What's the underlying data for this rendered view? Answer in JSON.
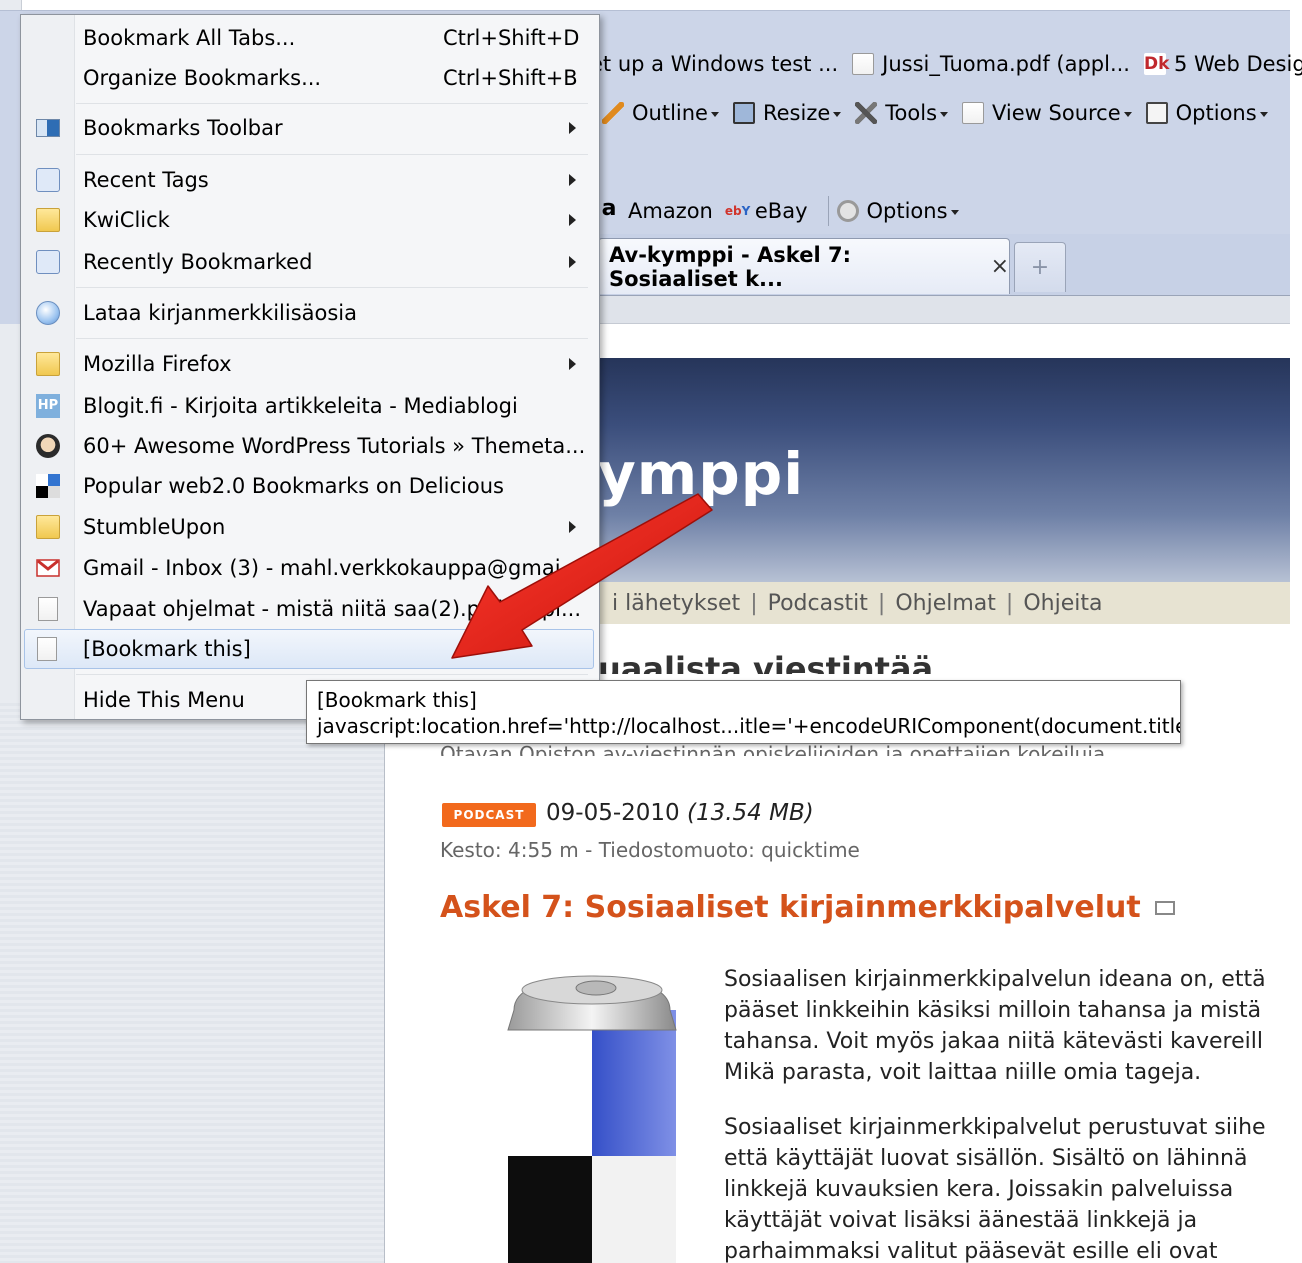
{
  "bookmarks_toolbar": {
    "items": [
      {
        "label": "et up a Windows test ...",
        "icon": "page-icon"
      },
      {
        "label": "Jussi_Tuoma.pdf (appl...",
        "icon": "page-icon"
      },
      {
        "label": "5 Web Design",
        "icon": "dr-icon"
      }
    ]
  },
  "dev_toolbar": {
    "items": [
      {
        "label": "Outline",
        "icon": "pencil-icon"
      },
      {
        "label": "Resize",
        "icon": "resize-icon"
      },
      {
        "label": "Tools",
        "icon": "tools-icon"
      },
      {
        "label": "View Source",
        "icon": "document-icon"
      },
      {
        "label": "Options",
        "icon": "options-icon"
      }
    ]
  },
  "search_toolbar": {
    "items": [
      {
        "label": "Amazon",
        "icon": "amazon-icon"
      },
      {
        "label": "eBay",
        "icon": "ebay-icon"
      },
      {
        "label": "Options",
        "icon": "gear-icon"
      }
    ]
  },
  "tabs": {
    "active_label": "Av-kymppi - Askel 7: Sosiaaliset k...",
    "close_glyph": "×",
    "new_tab_glyph": "+"
  },
  "menu": {
    "items": [
      {
        "label": "Bookmark All Tabs...",
        "shortcut": "Ctrl+Shift+D"
      },
      {
        "label": "Organize Bookmarks...",
        "shortcut": "Ctrl+Shift+B"
      },
      {
        "label": "Bookmarks Toolbar"
      },
      {
        "label": "Recent Tags"
      },
      {
        "label": "KwiClick"
      },
      {
        "label": "Recently Bookmarked"
      },
      {
        "label": "Lataa kirjanmerkkilisäosia"
      },
      {
        "label": "Mozilla Firefox"
      },
      {
        "label": "Blogit.fi - Kirjoita artikkeleita - Mediablogi"
      },
      {
        "label": "60+ Awesome WordPress Tutorials » Themeta..."
      },
      {
        "label": "Popular web2.0 Bookmarks on Delicious"
      },
      {
        "label": "StumbleUpon"
      },
      {
        "label": "Gmail - Inbox (3) - mahl.verkkokauppa@gmai..."
      },
      {
        "label": "Vapaat ohjelmat - mistä niitä saa(2).pdf (appl..."
      },
      {
        "label": "[Bookmark this]"
      },
      {
        "label": "Hide This Menu"
      }
    ]
  },
  "tooltip": {
    "title": "[Bookmark this]",
    "url": "javascript:location.href='http://localhost...itle='+encodeURIComponent(document.title)"
  },
  "page": {
    "banner_title": "ymppi",
    "nav": [
      "i lähetykset",
      "Podcastit",
      "Ohjelmat",
      "Ohjeita"
    ],
    "nav_separator": "|",
    "heading_partial": "uaalista viestintää",
    "subtitle_partial": "Otavan Opiston av-viestinnän opiskelijoiden ja opettajien kokeiluja",
    "badge": "PODCAST",
    "date": "09-05-2010",
    "size": "(13.54 MB)",
    "duration": "Kesto: 4:55 m - Tiedostomuoto: quicktime",
    "article_title": "Askel 7: Sosiaaliset kirjainmerkkipalvelut",
    "paragraph1": [
      "Sosiaalisen kirjainmerkkipalvelun ideana on, että",
      "pääset linkkeihin käsiksi milloin tahansa ja mistä",
      "tahansa. Voit myös jakaa niitä kätevästi kavereill",
      "Mikä parasta, voit laittaa niille omia tageja."
    ],
    "paragraph2": [
      "Sosiaaliset kirjainmerkkipalvelut perustuvat siihe",
      "että käyttäjät luovat sisällön. Sisältö on lähinnä",
      "linkkejä kuvauksien kera. Joissakin palveluissa",
      "käyttäjät voivat lisäksi äänestää linkkejä ja",
      "parhaimmaksi valitut pääsevät esille eli ovat"
    ]
  },
  "colors": {
    "accent_orange": "#d4521b",
    "badge_orange": "#f2691c",
    "arrow_red": "#e3241b",
    "chrome_blue": "#ccd5e8"
  }
}
